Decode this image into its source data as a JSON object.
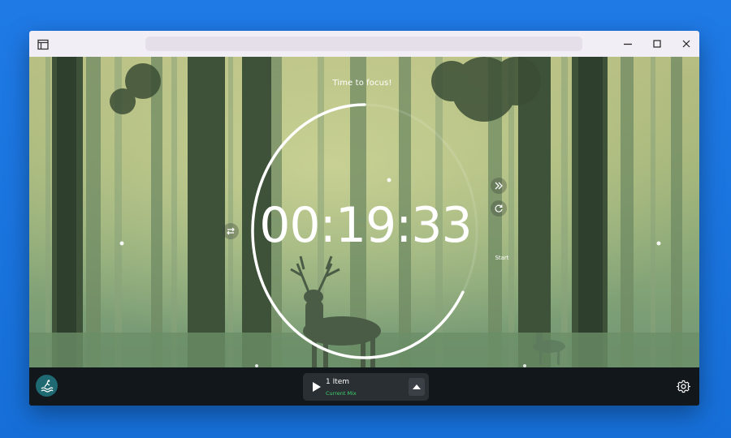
{
  "window": {
    "titlebar": {
      "app_icon": "window-layout-icon",
      "address_value": "",
      "controls": [
        "minimize-icon",
        "maximize-icon",
        "close-icon"
      ]
    }
  },
  "timer": {
    "label": "Time to focus!",
    "time": "00:19:33",
    "start_label": "Start",
    "ring_progress_fraction": 0.67
  },
  "side_controls": {
    "swap_icon": "swap-arrows-icon",
    "skip_icon": "double-chevron-right-icon",
    "reset_icon": "refresh-icon"
  },
  "player": {
    "title": "1 Item",
    "subtitle": "Current Mix",
    "play_icon": "play-icon",
    "expand_icon": "chevron-up-icon"
  },
  "bottombar": {
    "avatar_icon": "wave-person-icon",
    "settings_icon": "gear-icon"
  },
  "colors": {
    "desktop": "#1a73e0",
    "titlebar": "#f2eef5",
    "bottombar": "#12171c",
    "accent_green": "#3ecf6a",
    "avatar": "#1f6a72"
  }
}
